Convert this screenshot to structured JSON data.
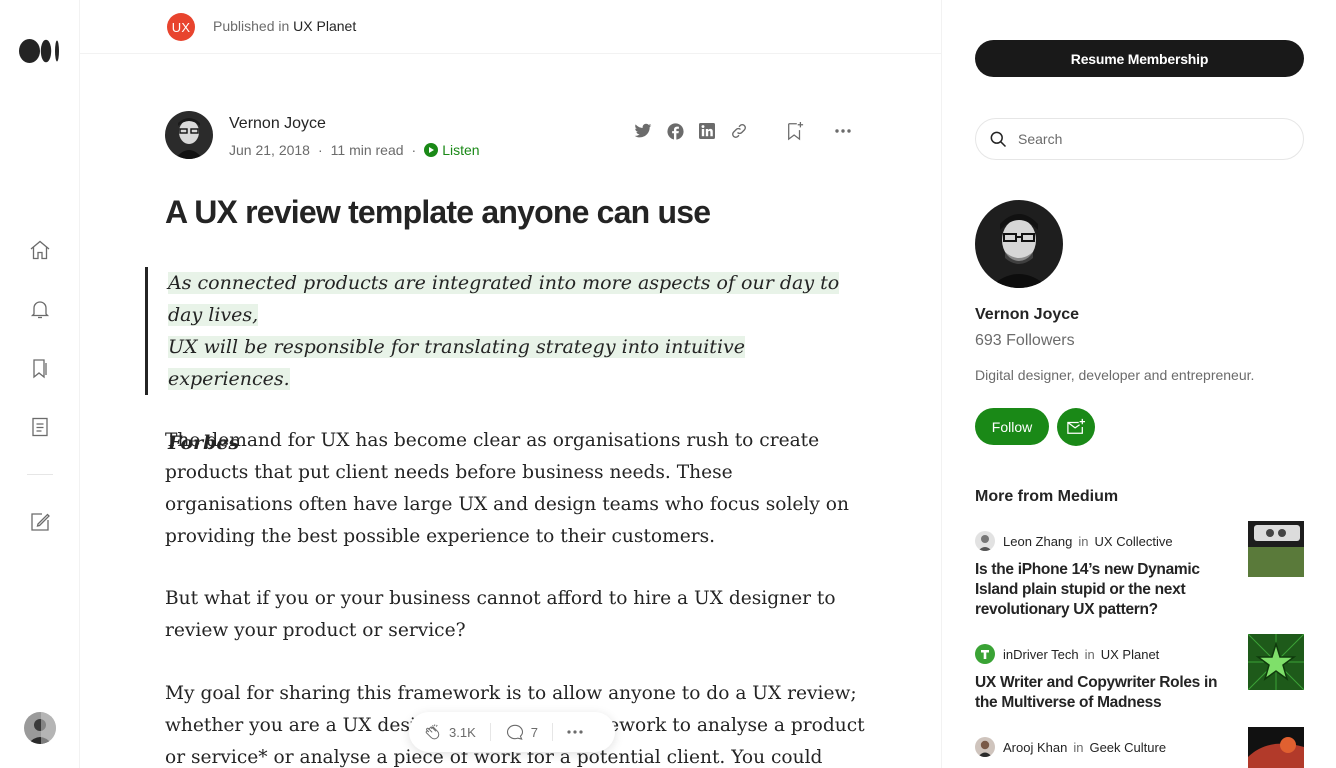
{
  "rail": {
    "icons": [
      "medium-logo-icon",
      "home-icon",
      "notifications-bell-icon",
      "bookmarks-list-icon",
      "stories-icon",
      "write-icon"
    ]
  },
  "publication": {
    "prefix": "Published in",
    "name": "UX Planet",
    "logo_text": "UX",
    "logo_color": "#e8442e"
  },
  "article": {
    "author": "Vernon Joyce",
    "date": "Jun 21, 2018",
    "read_time": "11 min read",
    "listen_label": "Listen",
    "title": "A UX review template anyone can use",
    "quote": {
      "line1": "As connected products are integrated into more aspects of our day to day lives,",
      "line2": "UX will be responsible for translating strategy into intuitive experiences.",
      "source": "Forbes"
    },
    "paragraphs": [
      "The demand for UX has become clear as organisations rush to create products that put client needs before business needs. These organisations often have large UX and design teams who focus solely on providing the best possible experience to their customers.",
      "But what if you or your business cannot afford to hire a UX designer to review your product or service?",
      "My goal for sharing this framework is to allow anyone to do a UX review; whether you are a UX designer using this framework to analyse a product or service* or analyse a piece of work for a potential client. You could"
    ],
    "claps": "3.1K",
    "responses": "7"
  },
  "sidebar": {
    "resume_label": "Resume Membership",
    "search_placeholder": "Search",
    "author_name": "Vernon Joyce",
    "followers": "693 Followers",
    "bio": "Digital designer, developer and entrepreneur.",
    "follow_label": "Follow",
    "more_heading": "More from Medium",
    "stories": [
      {
        "author": "Leon Zhang",
        "in": "in",
        "publication": "UX Collective",
        "title": "Is the iPhone 14’s new Dynamic Island plain stupid or the next revolutionary UX pattern?"
      },
      {
        "author": "inDriver Tech",
        "in": "in",
        "publication": "UX Planet",
        "title": "UX Writer and Copywriter Roles in the Multiverse of Madness"
      },
      {
        "author": "Arooj Khan",
        "in": "in",
        "publication": "Geek Culture",
        "title": ""
      }
    ]
  },
  "colors": {
    "accent_green": "#1a8917",
    "text": "#242424",
    "muted": "#6b6b6b",
    "highlight": "#e8f3e8",
    "dark_button": "#191919"
  }
}
